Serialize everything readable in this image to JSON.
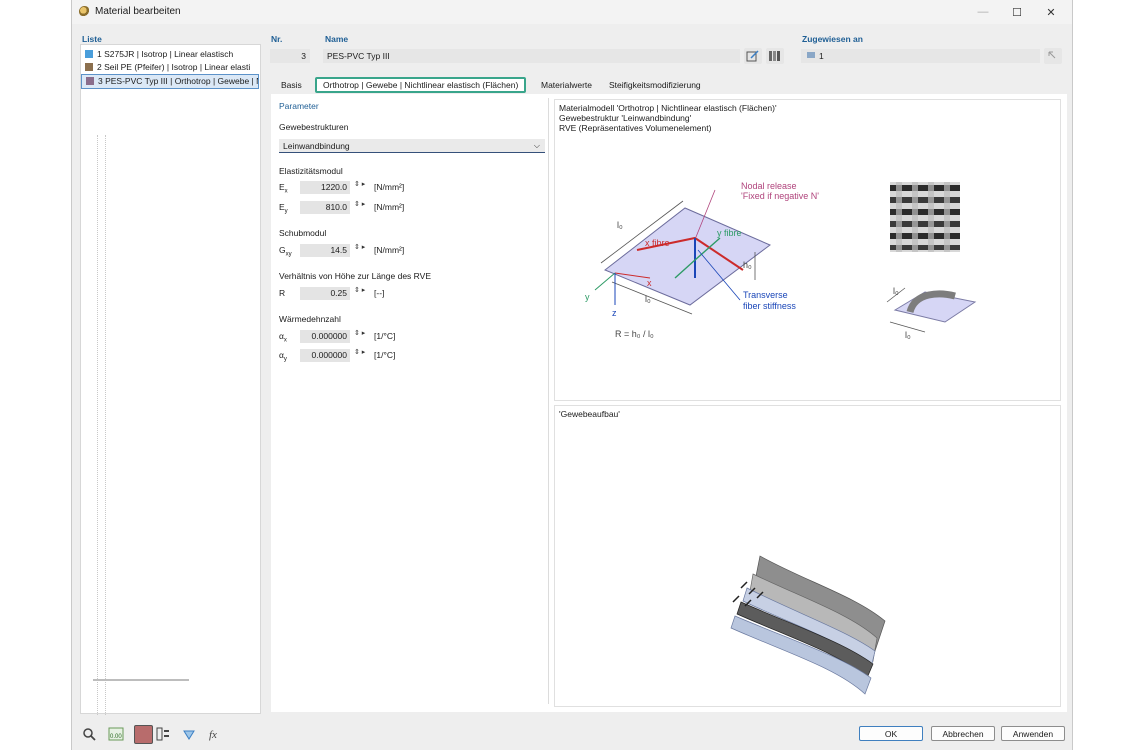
{
  "window": {
    "title": "Material bearbeiten",
    "icon": "material-icon"
  },
  "labels": {
    "liste": "Liste",
    "nr": "Nr.",
    "name": "Name",
    "zugewiesen": "Zugewiesen an"
  },
  "list": {
    "items": [
      {
        "label": "1  S275JR | Isotrop | Linear elastisch",
        "color": "#4a9edb"
      },
      {
        "label": "2  Seil PE (Pfeifer) | Isotrop | Linear elasti",
        "color": "#8b6f4e"
      },
      {
        "label": "3  PES-PVC Typ III | Orthotrop | Gewebe | Nich",
        "color": "#8a6d8c"
      }
    ]
  },
  "fields": {
    "nr": "3",
    "name": "PES-PVC Typ III",
    "assigned": "1"
  },
  "tabs": [
    {
      "label": "Basis"
    },
    {
      "label": "Orthotrop | Gewebe | Nichtlinear elastisch (Flächen)"
    },
    {
      "label": "Materialwerte"
    },
    {
      "label": "Steifigkeitsmodifizierung"
    }
  ],
  "params": {
    "header": "Parameter",
    "weave_label": "Gewebestrukturen",
    "weave_value": "Leinwandbindung",
    "elastic_label": "Elastizitätsmodul",
    "ex_sym": "E",
    "ex_sub": "x",
    "ex_val": "1220.0",
    "ex_unit": "[N/mm²]",
    "ey_sym": "E",
    "ey_sub": "y",
    "ey_val": "810.0",
    "ey_unit": "[N/mm²]",
    "shear_label": "Schubmodul",
    "g_sym": "G",
    "g_sub": "xy",
    "g_val": "14.5",
    "g_unit": "[N/mm²]",
    "ratio_label": "Verhältnis von Höhe zur Länge des RVE",
    "r_sym": "R",
    "r_val": "0.25",
    "r_unit": "[--]",
    "thermal_label": "Wärmedehnzahl",
    "ax_sym": "α",
    "ax_sub": "x",
    "ax_val": "0.000000",
    "ax_unit": "[1/°C]",
    "ay_sym": "α",
    "ay_sub": "y",
    "ay_val": "0.000000",
    "ay_unit": "[1/°C]"
  },
  "diagram": {
    "caption1": "Materialmodell 'Orthotrop | Nichtlinear elastisch (Flächen)'",
    "caption2": "Gewebestruktur 'Leinwandbindung'",
    "caption3": "RVE (Repräsentatives Volumenelement)",
    "nodal_release": "Nodal release",
    "fixed_negative": "'Fixed if negative N'",
    "x_fibre": "x fibre",
    "y_fibre": "y fibre",
    "transverse": "Transverse",
    "fiber_stiffness": "fiber stiffness",
    "formula": "R = h₀ / l₀",
    "l0": "l₀",
    "h0": "h₀",
    "axis_x": "x",
    "axis_y": "y",
    "axis_z": "z"
  },
  "layers": {
    "caption": "'Gewebeaufbau'"
  },
  "buttons": {
    "ok": "OK",
    "cancel": "Abbrechen",
    "apply": "Anwenden"
  },
  "colors": {
    "accent": "#1f5f95",
    "active_tab_border": "#39a58b",
    "red": "#cc2b2b",
    "blue": "#1a46b8",
    "green": "#2e9b66",
    "magenta": "#b0447c"
  }
}
